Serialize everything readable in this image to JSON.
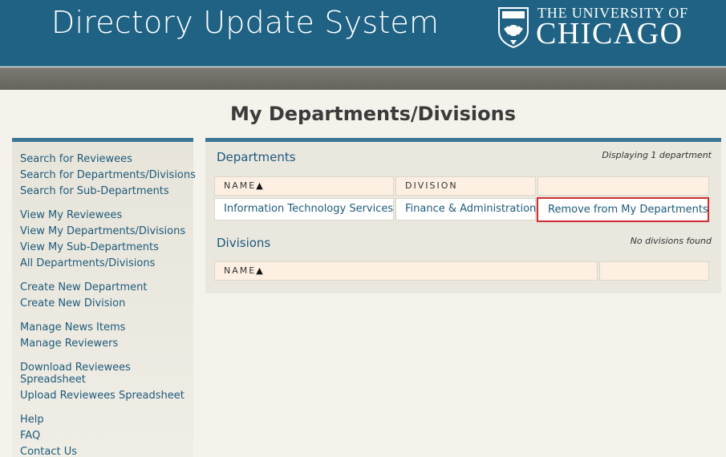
{
  "header": {
    "app_title": "Directory Update System",
    "logo_line1": "THE UNIVERSITY OF",
    "logo_line2": "CHICAGO",
    "bg_color": "#1f6283",
    "logo_icon": "university-shield-icon"
  },
  "page": {
    "title": "My Departments/Divisions"
  },
  "sidebar": {
    "groups": [
      [
        "Search for Reviewees",
        "Search for Departments/Divisions",
        "Search for Sub-Departments"
      ],
      [
        "View My Reviewees",
        "View My Departments/Divisions",
        "View My Sub-Departments",
        "All Departments/Divisions"
      ],
      [
        "Create New Department",
        "Create New Division"
      ],
      [
        "Manage News Items",
        "Manage Reviewers"
      ],
      [
        "Download Reviewees Spreadsheet",
        "Upload Reviewees Spreadsheet"
      ],
      [
        "Help",
        "FAQ",
        "Contact Us"
      ]
    ]
  },
  "departments": {
    "heading": "Departments",
    "meta": "Displaying 1 department",
    "columns": [
      "NAME",
      "DIVISION"
    ],
    "sort_indicator": "▲",
    "rows": [
      {
        "name": "Information Technology Services",
        "division": "Finance & Administration",
        "action": "Remove from My Departments"
      }
    ]
  },
  "divisions": {
    "heading": "Divisions",
    "meta": "No divisions found",
    "columns": [
      "NAME"
    ],
    "sort_indicator": "▲"
  },
  "colors": {
    "accent": "#1f6283",
    "link": "#1d5a7a",
    "highlight_border": "#d32f2f",
    "table_header_bg": "#fdf0e3"
  }
}
